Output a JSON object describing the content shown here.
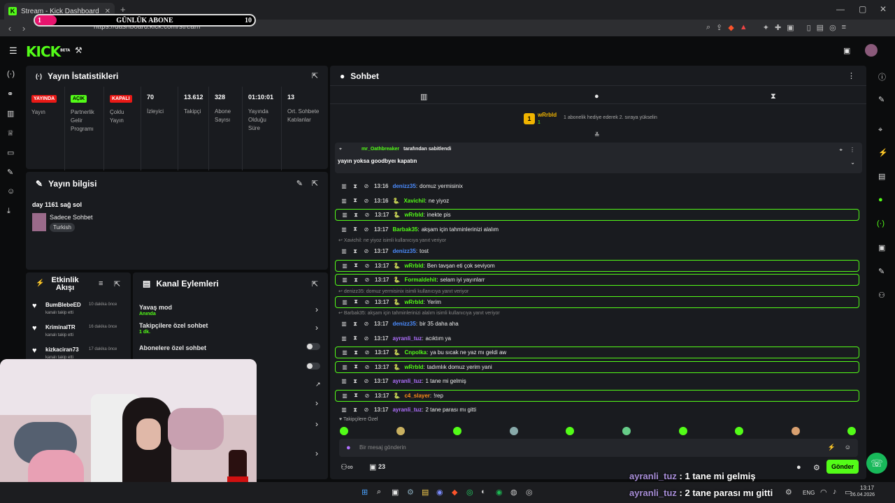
{
  "browser": {
    "tab_title": "Stream - Kick Dashboard",
    "tab_fav": "K",
    "url": "https://dashboard.kick.com/stream"
  },
  "overlay_sub": {
    "left": "1",
    "title": "GÜNLÜK ABONE",
    "right": "10",
    "progress": 0.1
  },
  "kick": {
    "logo": "KICK",
    "logo_sup": "BETA"
  },
  "stats": {
    "title": "Yayın İstatistikleri",
    "items": [
      {
        "badge": "YAYINDA",
        "label": "Yayın",
        "badge_color": "#e91916"
      },
      {
        "badge": "AÇIK",
        "label": "Partnerlik Gelir Programı",
        "badge_color": "#53fc18"
      },
      {
        "badge": "KAPALI",
        "label": "Çoklu Yayın",
        "badge_color": "#e91916"
      },
      {
        "value": "70",
        "label": "İzleyici"
      },
      {
        "value": "13.612",
        "label": "Takipçi"
      },
      {
        "value": "328",
        "label": "Abone Sayısı"
      },
      {
        "value": "01:10:01",
        "label": "Yayında Olduğu Süre"
      },
      {
        "value": "13",
        "label": "Ort. Sohbete Katılanlar"
      }
    ]
  },
  "info": {
    "title": "Yayın bilgisi",
    "stream_title": "day 1161 sağ sol",
    "category": "Sadece Sohbet",
    "tag": "Turkish"
  },
  "activity": {
    "title": "Etkinlik Akışı",
    "items": [
      {
        "user": "BumBlebeED",
        "time": "10 dakika önce",
        "action": "kanalı takip etti"
      },
      {
        "user": "KriminalTR",
        "time": "16 dakika önce",
        "action": "kanalı takip etti"
      },
      {
        "user": "kizkaciran73",
        "time": "17 dakika önce",
        "action": "kanalı takip etti"
      }
    ]
  },
  "channel_actions": {
    "title": "Kanal Eylemleri",
    "items": [
      {
        "label": "Yavaş mod",
        "sub": "Anında"
      },
      {
        "label": "Takipçilere özel sohbet",
        "sub": "1 dk."
      },
      {
        "label": "Abonelere özel sohbet",
        "sub": ""
      }
    ]
  },
  "chat": {
    "title": "Sohbet",
    "top_gifter": {
      "user": "wRrbld",
      "rank": "1",
      "count": "1",
      "text": "1 abonelik hediye ederek 2. sıraya yükselin"
    },
    "pinned": {
      "by": "mr_Oathbreaker",
      "by_suffix": "tarafından sabitlendi",
      "text": "yayın yoksa goodbyeı kapatın"
    },
    "messages": [
      {
        "time": "13:16",
        "user": "denizz35",
        "color": "#4c8dff",
        "text": "domuz yermisinix",
        "hl": false,
        "badge": false
      },
      {
        "time": "13:16",
        "user": "Xavichil",
        "color": "#53fc18",
        "text": "ne yiyoz",
        "hl": false,
        "badge": true
      },
      {
        "time": "13:17",
        "user": "wRrbld",
        "color": "#53fc18",
        "text": "inekte pis",
        "hl": true,
        "badge": true
      },
      {
        "time": "13:17",
        "user": "Barbak35",
        "color": "#53fc18",
        "text": "akşam için tahminlerinizi alalım",
        "hl": false,
        "badge": false
      },
      {
        "time": "13:17",
        "user": "denizz35",
        "color": "#4c8dff",
        "text": "tost",
        "hl": false,
        "badge": false,
        "reply": "Xavichil: ne yiyoz isimli kullanıcıya yanıt veriyor"
      },
      {
        "time": "13:17",
        "user": "wRrbld",
        "color": "#53fc18",
        "text": "Ben tavşan eti çok seviyom",
        "hl": true,
        "badge": true
      },
      {
        "time": "13:17",
        "user": "Formaldehit",
        "color": "#53fc18",
        "text": "selam iyi yayınlarr",
        "hl": true,
        "badge": true
      },
      {
        "time": "13:17",
        "user": "wRrbld",
        "color": "#53fc18",
        "text": "Yerim",
        "hl": true,
        "badge": true,
        "reply": "denizz35: domuz yermisinix isimli kullanıcıya yanıt veriyor"
      },
      {
        "time": "13:17",
        "user": "denizz35",
        "color": "#4c8dff",
        "text": "bir 35 daha aha",
        "hl": false,
        "badge": false,
        "reply": "Barbak35: akşam için tahminlerinizi alalım isimli kullanıcıya yanıt veriyor"
      },
      {
        "time": "13:17",
        "user": "ayranli_tuz",
        "color": "#b070ff",
        "text": "acıktım ya",
        "hl": false,
        "badge": false
      },
      {
        "time": "13:17",
        "user": "Cnpolka",
        "color": "#53fc18",
        "text": "ya bu sıcak ne yaz mı geldi aw",
        "hl": true,
        "badge": true
      },
      {
        "time": "13:17",
        "user": "wRrbld",
        "color": "#53fc18",
        "text": "tadımlık domuz yerim yani",
        "hl": true,
        "badge": true
      },
      {
        "time": "13:17",
        "user": "ayranli_tuz",
        "color": "#b070ff",
        "text": "1 tane mi gelmiş",
        "hl": false,
        "badge": false
      },
      {
        "time": "13:17",
        "user": "c4_slayer",
        "color": "#ff8c1a",
        "text": "!rep",
        "hl": true,
        "badge": true
      },
      {
        "time": "13:17",
        "user": "ayranli_tuz",
        "color": "#b070ff",
        "text": "2 tane parası mı gitti",
        "hl": false,
        "badge": false
      }
    ],
    "emote_section": "Takipçilere Özel",
    "input_placeholder": "Bir mesaj gönderin",
    "viewers_count": "23",
    "send_label": "Gönder"
  },
  "overlay_chat": [
    {
      "user": "ayranli_tuz",
      "text": "1 tane mi gelmiş"
    },
    {
      "user": "ayranli_tuz",
      "text": "2 tane parası mı gitti"
    }
  ],
  "taskbar": {
    "lang": "ENG",
    "time": "13:17",
    "date": "26.04.2026"
  }
}
